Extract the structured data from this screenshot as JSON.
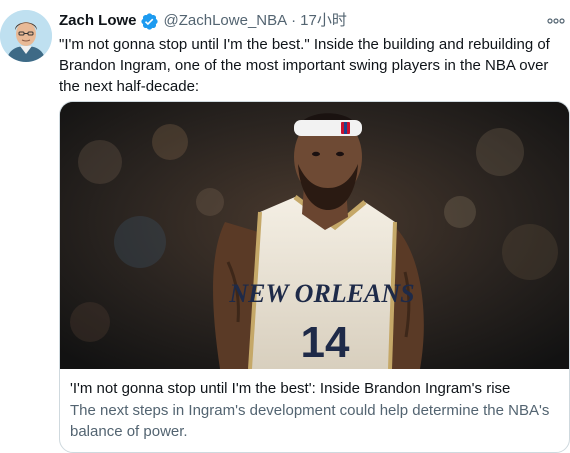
{
  "tweet": {
    "author": {
      "display_name": "Zach Lowe",
      "verified_icon": "verified-badge-icon",
      "handle": "@ZachLowe_NBA",
      "separator": "·",
      "time": "17小时"
    },
    "more_icon": "more-dots-icon",
    "text": "\"I'm not gonna stop until I'm the best.\" Inside the building and rebuilding of Brandon Ingram, one of the most important swing players in the NBA over the next half-decade:",
    "card": {
      "title": "'I'm not gonna stop until I'm the best': Inside Brandon Ingram's rise",
      "description": "The next steps in Ingram's development could help determine the NBA's balance of power.",
      "image_jersey_text": "NEW ORLEANS",
      "image_jersey_number": "14"
    }
  },
  "colors": {
    "verified_blue": "#1d9bf0",
    "text_primary": "#0f1419",
    "text_secondary": "#536471",
    "card_border": "#cfd9de"
  }
}
